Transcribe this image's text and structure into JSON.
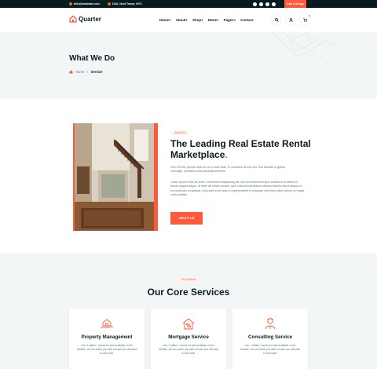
{
  "topbar": {
    "email": "info@webmail.com",
    "address": "15/A, Nest Tower, NYC",
    "add_listing": "Add Listings",
    "social": [
      "facebook-icon",
      "twitter-icon",
      "instagram-icon",
      "dribbble-icon"
    ]
  },
  "header": {
    "logo": "Quarter",
    "nav": [
      "Home",
      "About",
      "Shop",
      "News",
      "Pages",
      "Contact"
    ],
    "cart_count": "2"
  },
  "breadcrumb": {
    "title": "What We Do",
    "home": "Home",
    "separator": "»",
    "current": "Service"
  },
  "about": {
    "tag": "About Us",
    "title_main": "The Leading Real Estate Rental Marketplace",
    "title_dot": ".",
    "lead": "Over 39,000 people work for us in more than 70 countries all over the This breadth of global coverage, combined with specialist services",
    "body": "Lorem ipsum dolor sit amet, consectetur adipisicing elit, sed do eiusmod tempor incididunt ut labore et dolore magna aliqua. Ut enim ad minim veniam, quis nostrud exercitation ullamco laboris nisi ut aliquip ex ea commodo consequat. Duis aute irure dolor in reprehenderit in voluptate velit esse cillum dolore eu fugiat nulla pariatur.",
    "button": "ABOUT US"
  },
  "services": {
    "tag": "Our Services",
    "title": "Our Core Services",
    "cards": [
      {
        "title": "Property Management",
        "text": "over 1 million+ homes for sale available on the website, we can match you with a house you will want to call home.",
        "icon": "house-hand-icon"
      },
      {
        "title": "Mortgage Service",
        "text": "over 1 million+ homes for sale available on the website, we can match you with a house you will want to call home.",
        "icon": "house-percent-icon"
      },
      {
        "title": "Consulting Service",
        "text": "over 1 million+ homes for sale available on the website, we can match you with a house you will want to call home.",
        "icon": "consultant-icon"
      }
    ]
  },
  "colors": {
    "accent": "#ff5a3c",
    "dark": "#071c1f",
    "muted": "#5c727d",
    "band": "#f2f6f7"
  }
}
